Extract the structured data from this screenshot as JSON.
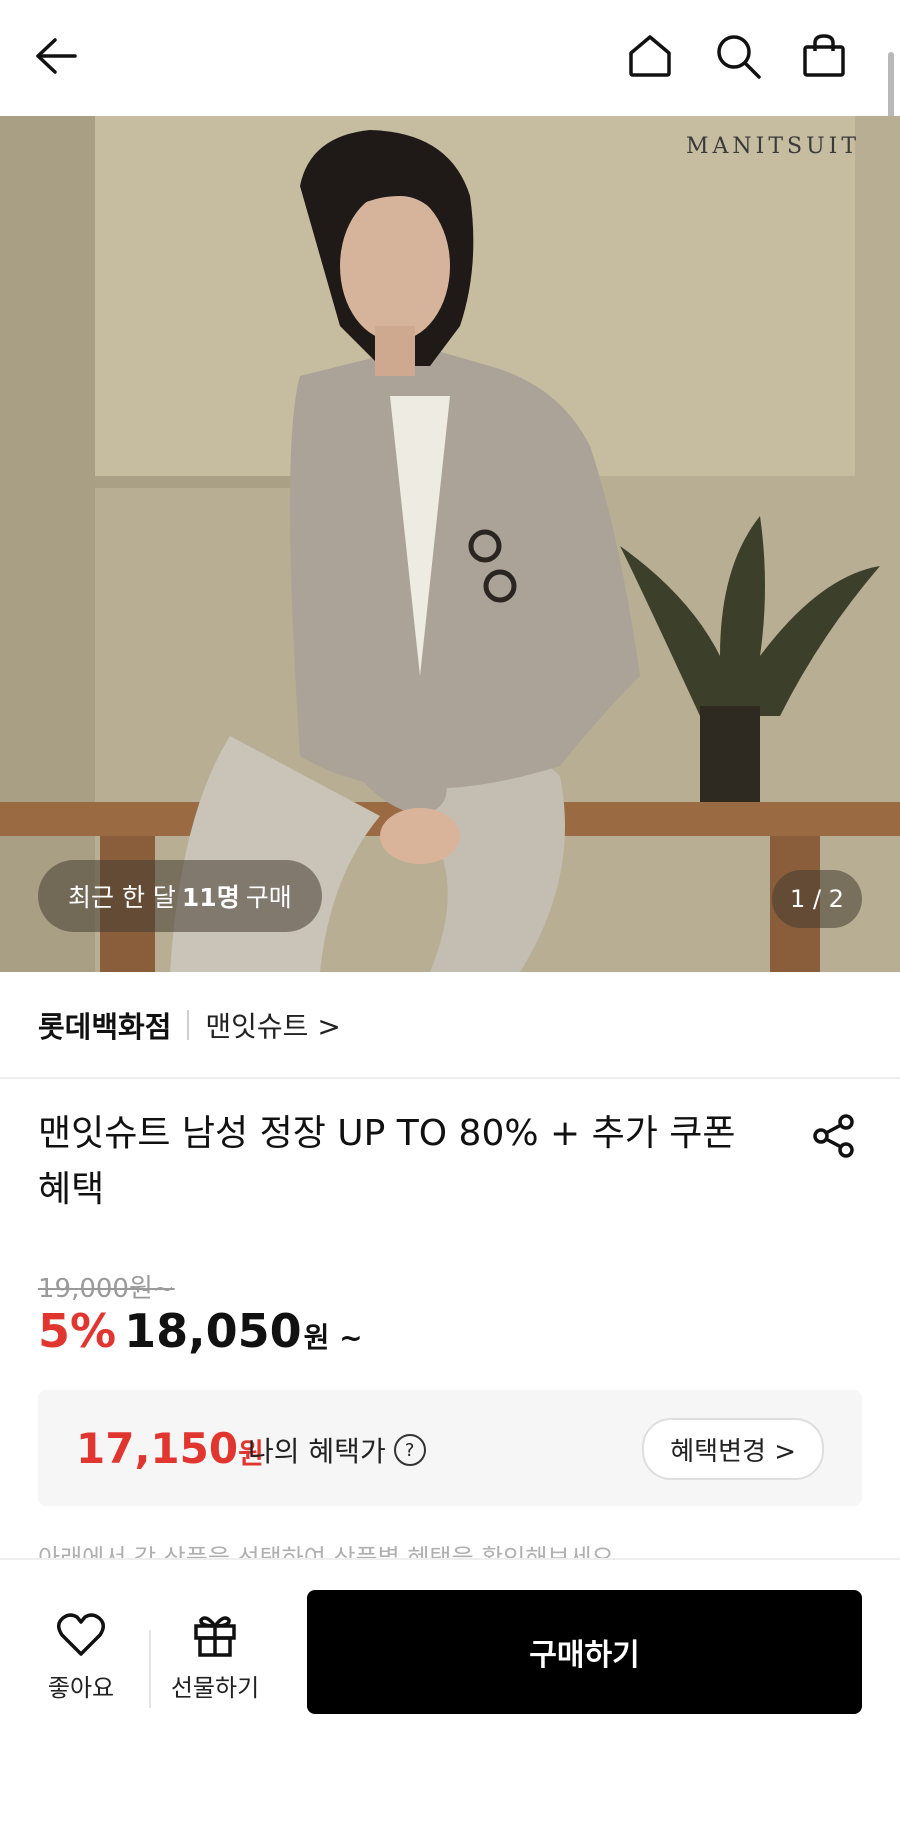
{
  "header": {
    "back_icon": "arrow-left-icon",
    "home_icon": "home-icon",
    "search_icon": "search-icon",
    "cart_icon": "shopping-bag-icon"
  },
  "hero": {
    "watermark": "MANITSUIT",
    "recent_prefix": "최근 한 달",
    "recent_count": "11명",
    "recent_suffix": "구매",
    "counter": "1 / 2"
  },
  "seller": {
    "store": "롯데백화점",
    "brand": "맨잇슈트 >"
  },
  "product": {
    "title": "맨잇슈트 남성 정장 UP TO 80% + 추가 쿠폰 혜택",
    "share_icon": "share-icon",
    "original_price": "19,000원~",
    "discount": "5%",
    "price": "18,050",
    "price_unit": "원 ~"
  },
  "benefit": {
    "price": "17,150",
    "unit": "원",
    "label": "나의 혜택가",
    "help_icon": "question-circle-icon",
    "help_glyph": "?",
    "change_button": "혜택변경 >"
  },
  "notice": "아래에서 각 상품을 선택하여 상품별 혜택을 확인해보세요",
  "bottom_bar": {
    "like_label": "좋아요",
    "gift_label": "선물하기",
    "buy_label": "구매하기"
  },
  "colors": {
    "accent_red": "#e0362f",
    "buy_button": "#000000"
  }
}
